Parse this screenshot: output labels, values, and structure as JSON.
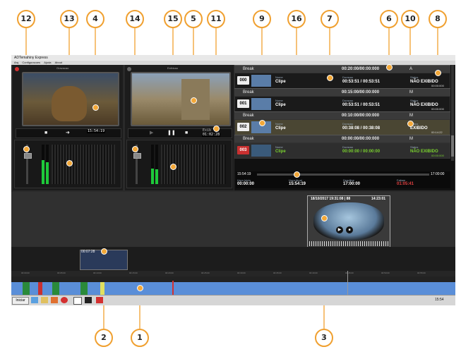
{
  "app": {
    "title": "ADTemahiny Express",
    "menu": [
      "Arq",
      "Configuracoes",
      "Ajuda",
      "About"
    ]
  },
  "monitors": {
    "left": {
      "label": "Gravacao",
      "timecode": "15:54:19"
    },
    "right": {
      "label": "Exibicao",
      "timecode_label": "Exib",
      "timecode": "01:02:28"
    }
  },
  "vu_scale": [
    "-0",
    "-6",
    "-12",
    "-18",
    "-24"
  ],
  "playlist": {
    "header_total": "00:20:00/00:00:000",
    "header_mode": "A",
    "items": [
      {
        "block": "Break",
        "block_time": "00:20:00/00:00:000",
        "block_mode": "A",
        "num": "000",
        "type_label": "Nome",
        "type": "Clipe",
        "dur_label": "Duracao",
        "duration": "00:53:51 / 00:53:51",
        "status_label": "Status",
        "status": "NÃO EXIBIDO",
        "time": "00:00:000"
      },
      {
        "block": "Break",
        "block_time": "00:15:00/00:00:000",
        "block_mode": "M",
        "num": "001",
        "type_label": "Nome",
        "type": "Clipe",
        "dur_label": "Duracao",
        "duration": "00:53:51 / 00:53:51",
        "status_label": "Status",
        "status": "NÃO EXIBIDO",
        "time": "00:00:000"
      },
      {
        "block": "Break",
        "block_time": "00:10:00/00:00:000",
        "block_mode": "M",
        "num": "002",
        "type_label": "Nome",
        "type": "Clipe",
        "dur_label": "Duracao",
        "duration": "00:38:08 / 00:38:08",
        "status_label": "Status",
        "status": "EXIBIDO",
        "time": "00:14:22"
      },
      {
        "block": "Break",
        "block_time": "00:00:00/00:00:000",
        "block_mode": "M",
        "num": "003",
        "type_label": "Nome",
        "type": "Clipe",
        "dur_label": "Duracao",
        "duration": "00:00:00 / 00:00:00",
        "status_label": "Status",
        "status": "NÃO EXIBIDO",
        "time": "00:00:000"
      }
    ]
  },
  "progress": {
    "start": "15:54:19",
    "end": "17:00:00",
    "fields": [
      {
        "label": "Hora Inicio",
        "value": "00:00:00"
      },
      {
        "label": "Hora Atual",
        "value": "15:54:19"
      },
      {
        "label": "Deadline",
        "value": "17:00:00"
      },
      {
        "label": "Faltam",
        "value": "01:05:41"
      }
    ]
  },
  "preview_popup": {
    "header": "18/10/2017 19:31:08 | 88",
    "duration": "14:23:01"
  },
  "timeline": {
    "clip_label": "00:07:28",
    "scale": [
      "00:00:00",
      "00:05:00",
      "00:10:00",
      "00:15:00",
      "00:20:00",
      "00:25:00",
      "00:30:00",
      "00:35:00",
      "00:40:00",
      "00:45:00",
      "00:50:00",
      "00:55:00"
    ]
  },
  "taskbar": {
    "start": "Iniciar",
    "clock": "15:54"
  },
  "callouts": [
    "12",
    "13",
    "4",
    "14",
    "15",
    "5",
    "11",
    "9",
    "16",
    "7",
    "6",
    "10",
    "8",
    "2",
    "1",
    "3"
  ],
  "colors": {
    "accent": "#f0a030",
    "green": "#7ad12f",
    "red": "#e04040"
  }
}
